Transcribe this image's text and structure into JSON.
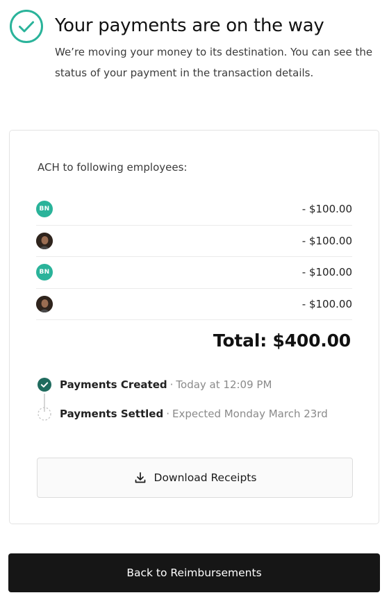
{
  "header": {
    "title": "Your payments are on the way",
    "subtitle": "We’re moving your money to its destination. You can see the status of your payment in the transaction details.",
    "icon": "check-circle-icon",
    "accent_color": "#2ab39a"
  },
  "card": {
    "label": "ACH to following employees:",
    "employees": [
      {
        "avatar_type": "initials",
        "initials": "BN",
        "amount": "- $100.00"
      },
      {
        "avatar_type": "photo",
        "initials": "",
        "amount": "- $100.00"
      },
      {
        "avatar_type": "initials",
        "initials": "BN",
        "amount": "- $100.00"
      },
      {
        "avatar_type": "photo",
        "initials": "",
        "amount": "- $100.00"
      }
    ],
    "total": "Total: $400.00",
    "timeline": [
      {
        "title": "Payments Created",
        "separator": "·",
        "meta": "Today at 12:09 PM",
        "status": "complete"
      },
      {
        "title": "Payments Settled",
        "separator": "·",
        "meta": "Expected Monday March 23rd",
        "status": "pending"
      }
    ],
    "download_label": "Download Receipts",
    "download_icon": "download-icon"
  },
  "footer": {
    "back_label": "Back to Reimbursements"
  }
}
